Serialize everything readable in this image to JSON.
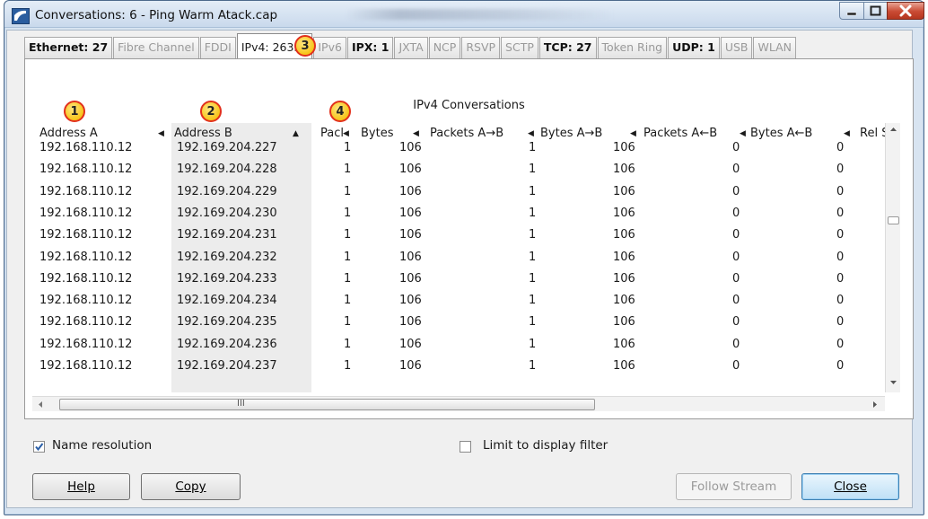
{
  "window": {
    "title": "Conversations: 6 - Ping Warm Atack.cap"
  },
  "callouts": [
    "1",
    "2",
    "3",
    "4"
  ],
  "tabs": [
    {
      "label": "Ethernet: 27",
      "state": "bold"
    },
    {
      "label": "Fibre Channel",
      "state": "dim"
    },
    {
      "label": "FDDI",
      "state": "dim"
    },
    {
      "label": "IPv4: 26331",
      "state": "active"
    },
    {
      "label": "IPv6",
      "state": "dim"
    },
    {
      "label": "IPX: 1",
      "state": "bold"
    },
    {
      "label": "JXTA",
      "state": "dim"
    },
    {
      "label": "NCP",
      "state": "dim"
    },
    {
      "label": "RSVP",
      "state": "dim"
    },
    {
      "label": "SCTP",
      "state": "dim"
    },
    {
      "label": "TCP: 27",
      "state": "bold"
    },
    {
      "label": "Token Ring",
      "state": "dim"
    },
    {
      "label": "UDP: 1",
      "state": "bold"
    },
    {
      "label": "USB",
      "state": "dim"
    },
    {
      "label": "WLAN",
      "state": "dim"
    }
  ],
  "panel": {
    "title": "IPv4 Conversations"
  },
  "columns": [
    "Address A",
    "Address B",
    "Pacl",
    "Bytes",
    "Packets A→B",
    "Bytes A→B",
    "Packets A←B",
    "Bytes A←B",
    "Rel St"
  ],
  "rows": [
    [
      "192.168.110.12",
      "192.169.204.227",
      "1",
      "106",
      "1",
      "106",
      "0",
      "0"
    ],
    [
      "192.168.110.12",
      "192.169.204.228",
      "1",
      "106",
      "1",
      "106",
      "0",
      "0"
    ],
    [
      "192.168.110.12",
      "192.169.204.229",
      "1",
      "106",
      "1",
      "106",
      "0",
      "0"
    ],
    [
      "192.168.110.12",
      "192.169.204.230",
      "1",
      "106",
      "1",
      "106",
      "0",
      "0"
    ],
    [
      "192.168.110.12",
      "192.169.204.231",
      "1",
      "106",
      "1",
      "106",
      "0",
      "0"
    ],
    [
      "192.168.110.12",
      "192.169.204.232",
      "1",
      "106",
      "1",
      "106",
      "0",
      "0"
    ],
    [
      "192.168.110.12",
      "192.169.204.233",
      "1",
      "106",
      "1",
      "106",
      "0",
      "0"
    ],
    [
      "192.168.110.12",
      "192.169.204.234",
      "1",
      "106",
      "1",
      "106",
      "0",
      "0"
    ],
    [
      "192.168.110.12",
      "192.169.204.235",
      "1",
      "106",
      "1",
      "106",
      "0",
      "0"
    ],
    [
      "192.168.110.12",
      "192.169.204.236",
      "1",
      "106",
      "1",
      "106",
      "0",
      "0"
    ],
    [
      "192.168.110.12",
      "192.169.204.237",
      "1",
      "106",
      "1",
      "106",
      "0",
      "0"
    ]
  ],
  "options": {
    "name_resolution": "Name resolution",
    "name_resolution_checked": true,
    "limit_filter": "Limit to display filter",
    "limit_filter_checked": false
  },
  "buttons": {
    "help": "Help",
    "copy": "Copy",
    "follow": "Follow Stream",
    "close": "Close"
  },
  "scroll_glyph": "III",
  "colors": {
    "callout_fill": "#f7c51a",
    "callout_ring": "#e2301c",
    "titlebar": "#c9d9ec",
    "close_button": "#c94a33"
  }
}
